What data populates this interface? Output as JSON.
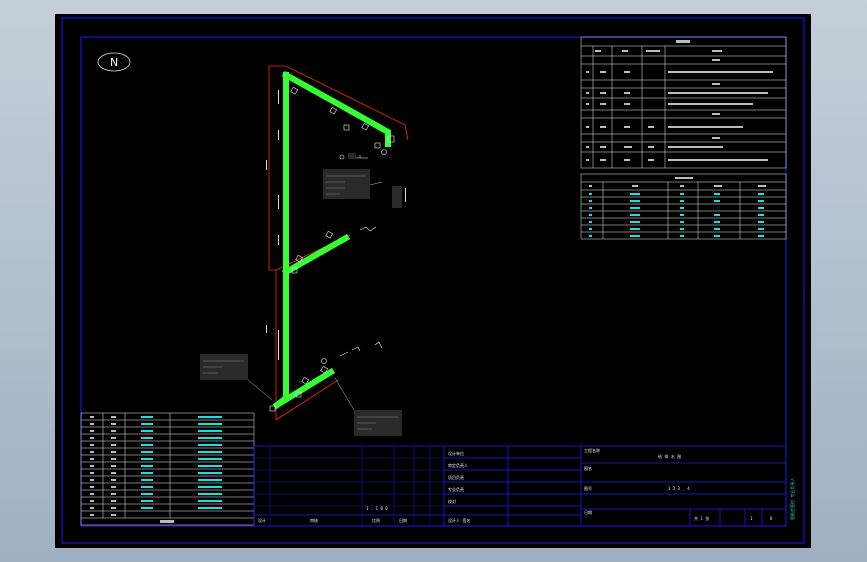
{
  "drawing": {
    "north_label": "N",
    "colors": {
      "background": "#000000",
      "frame": "#1a1aff",
      "pipe": "#33ff33",
      "wall": "#ff2222",
      "cyan_text": "#18e0e0",
      "white_text": "#e8e8e8"
    },
    "scale_note": "1 : 1 0 0",
    "title_block": {
      "left_labels": [
        "设计",
        "审核",
        "比例",
        "日期"
      ],
      "center_rows": [
        "设计单位",
        "审定负责人",
        "项目负责",
        "专业负责",
        "校对",
        "设计人 签名"
      ],
      "drawing_name": "给 排 水 图",
      "drawing_no": "1 2 3 _ 4",
      "sheet_no": "共 1 张",
      "sheet_index": "1",
      "sheet_total": "8",
      "field_labels": [
        "工程名称",
        "图名",
        "图号",
        "日期"
      ]
    },
    "stamp_vertical": "图纸会签栏 专业负责人"
  }
}
